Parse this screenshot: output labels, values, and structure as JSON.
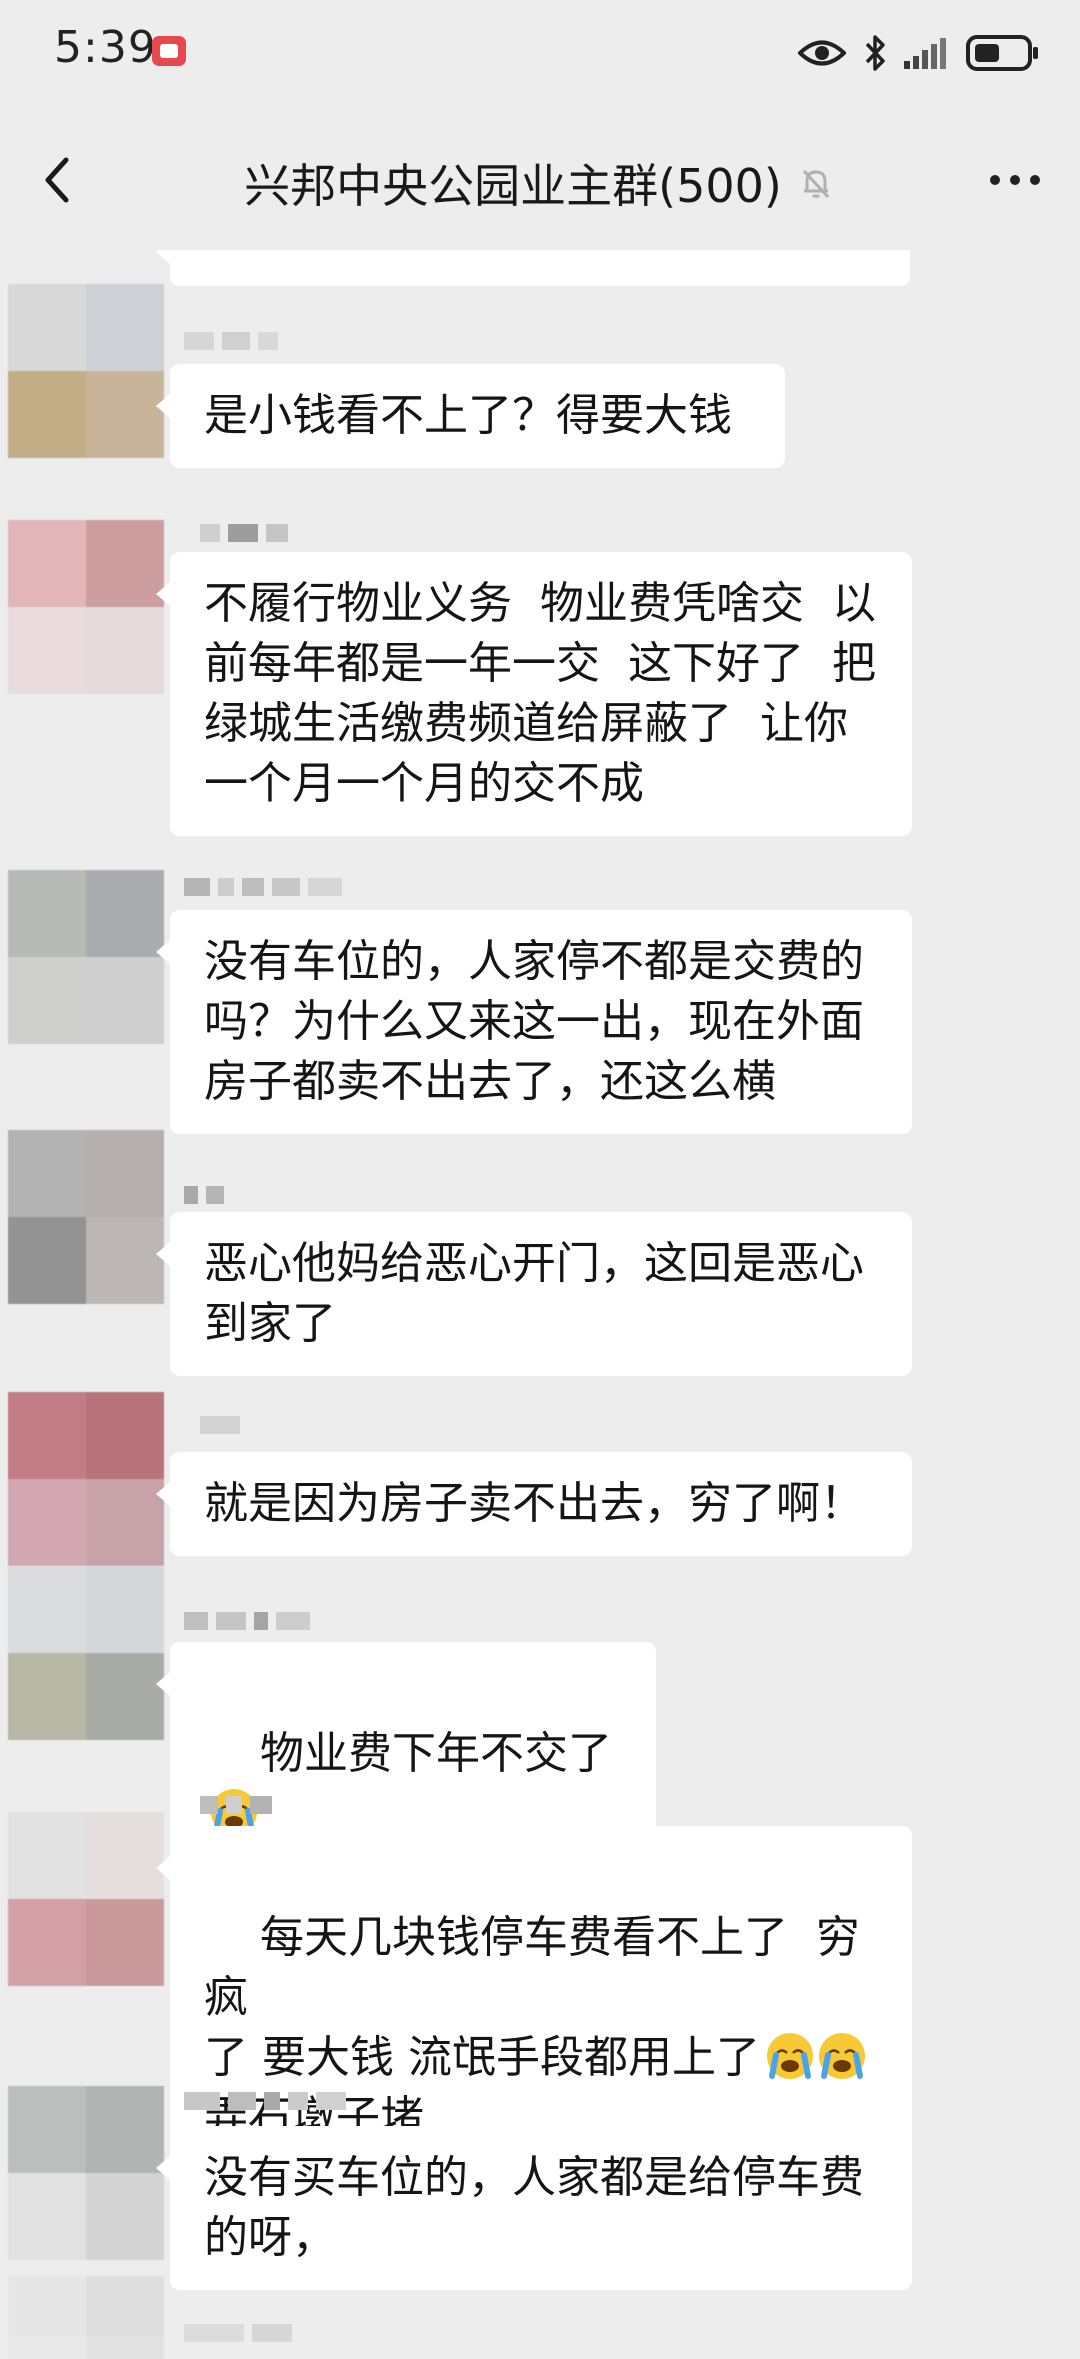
{
  "status_bar": {
    "time": "5:39"
  },
  "title_bar": {
    "title": "兴邦中央公园业主群(500)"
  },
  "messages": [
    {
      "text": "是小钱看不上了？得要大钱"
    },
    {
      "text": "不履行物业义务  物业费凭啥交  以\n前每年都是一年一交  这下好了  把\n绿城生活缴费频道给屏蔽了  让你\n一个月一个月的交不成"
    },
    {
      "text": "没有车位的，人家停不都是交费的\n吗？为什么又来这一出，现在外面\n房子都卖不出去了，还这么横"
    },
    {
      "text": "恶心他妈给恶心开门，这回是恶心\n到家了"
    },
    {
      "text": "就是因为房子卖不出去，穷了啊！"
    },
    {
      "text": "物业费下年不交了"
    },
    {
      "text_line1": "每天几块钱停车费看不上了  穷疯",
      "text_line2": "了 要大钱 流氓手段都用上了",
      "text_line3": "弄石墩子堵"
    },
    {
      "text": "没有买车位的，人家都是给停车费\n的呀，"
    }
  ],
  "icons": {
    "back": "chevron-left-icon",
    "mute": "bell-off-icon",
    "more": "more-dots-icon",
    "emoji": "loudly-crying-face-icon"
  }
}
